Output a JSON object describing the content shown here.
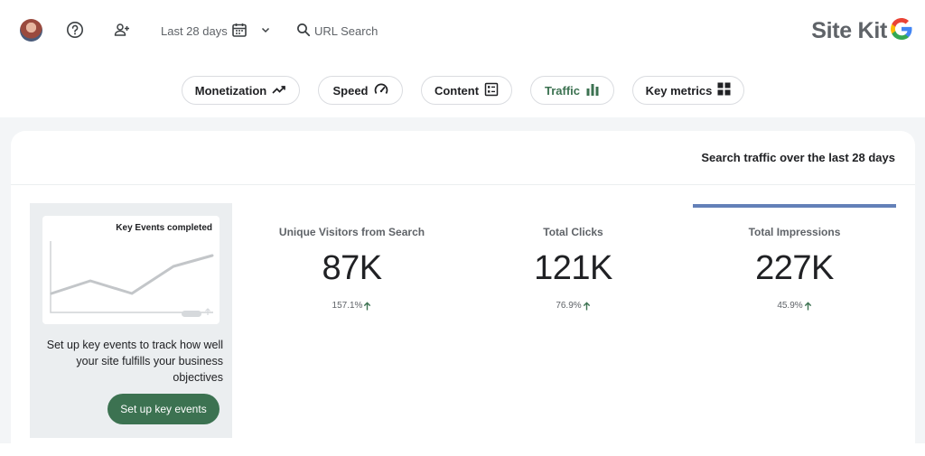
{
  "header": {
    "date_range": "Last 28 days",
    "url_search": "URL Search",
    "brand": "Site Kit"
  },
  "nav_chips": [
    {
      "label": "Monetization",
      "icon": "trending-up-icon"
    },
    {
      "label": "Speed",
      "icon": "speedometer-icon"
    },
    {
      "label": "Content",
      "icon": "list-box-icon"
    },
    {
      "label": "Traffic",
      "icon": "bar-chart-icon",
      "active": true
    },
    {
      "label": "Key metrics",
      "icon": "grid-icon"
    }
  ],
  "card": {
    "title": "Search traffic over the last 28 days"
  },
  "promo": {
    "mini_chart_title": "Key Events completed",
    "text": "Set up key events to track how well your site fulfills your business objectives",
    "button": "Set up key events"
  },
  "metrics": [
    {
      "label": "Unique Visitors from Search",
      "value": "87K",
      "change": "157.1%"
    },
    {
      "label": "Total Clicks",
      "value": "121K",
      "change": "76.9%"
    },
    {
      "label": "Total Impressions",
      "value": "227K",
      "change": "45.9%",
      "selected": true
    }
  ],
  "colors": {
    "accent_green": "#3c7251",
    "selected_tab": "#6380b8",
    "up_arrow": "#3c7251"
  }
}
